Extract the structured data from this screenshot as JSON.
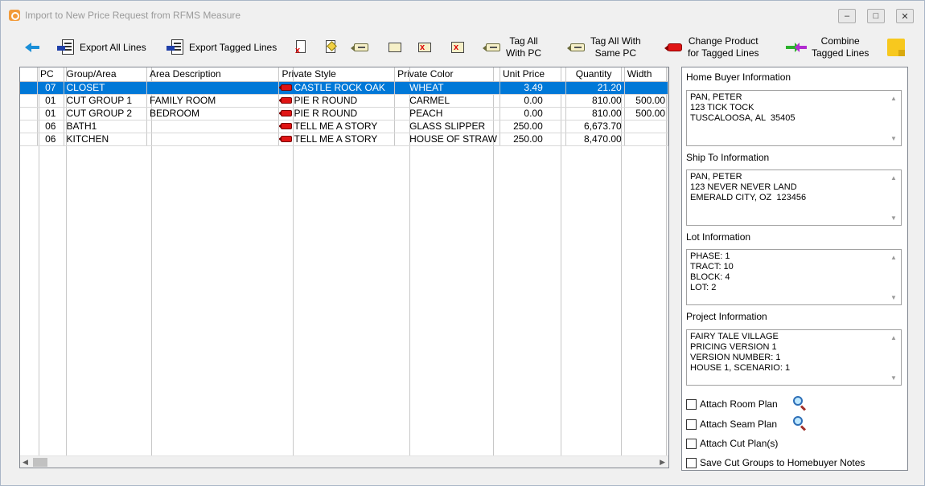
{
  "window": {
    "title": "Import to New Price Request from RFMS Measure"
  },
  "toolbar": {
    "export_all": "Export All Lines",
    "export_tagged": "Export Tagged Lines",
    "tag_all_pc_1": "Tag All",
    "tag_all_pc_2": "With PC",
    "tag_same_pc_1": "Tag All With",
    "tag_same_pc_2": "Same PC",
    "change_product_1": "Change Product",
    "change_product_2": "for Tagged Lines",
    "combine_1": "Combine",
    "combine_2": "Tagged Lines"
  },
  "grid": {
    "columns": [
      "PC",
      "Group/Area",
      "Area Description",
      "Private Style",
      "Private Color",
      "Unit Price",
      "Quantity",
      "Width"
    ],
    "rows": [
      {
        "pc": "07",
        "group": "CLOSET",
        "desc": "",
        "style": "CASTLE ROCK OAK",
        "color": "WHEAT",
        "price": "3.49",
        "qty": "21.20",
        "width": ""
      },
      {
        "pc": "01",
        "group": "CUT GROUP 1",
        "desc": "FAMILY ROOM",
        "style": "PIE R ROUND",
        "color": "CARMEL",
        "price": "0.00",
        "qty": "810.00",
        "width": "500.00"
      },
      {
        "pc": "01",
        "group": "CUT GROUP 2",
        "desc": "BEDROOM",
        "style": "PIE R ROUND",
        "color": "PEACH",
        "price": "0.00",
        "qty": "810.00",
        "width": "500.00"
      },
      {
        "pc": "06",
        "group": "BATH1",
        "desc": "",
        "style": "TELL ME A STORY",
        "color": "GLASS SLIPPER",
        "price": "250.00",
        "qty": "6,673.70",
        "width": ""
      },
      {
        "pc": "06",
        "group": "KITCHEN",
        "desc": "",
        "style": "TELL ME A STORY",
        "color": "HOUSE OF STRAW",
        "price": "250.00",
        "qty": "8,470.00",
        "width": ""
      }
    ]
  },
  "panel": {
    "home_buyer_label": "Home Buyer Information",
    "home_buyer": [
      "PAN, PETER",
      "123 TICK TOCK",
      "TUSCALOOSA, AL  35405"
    ],
    "ship_to_label": "Ship To Information",
    "ship_to": [
      "PAN, PETER",
      "123 NEVER NEVER LAND",
      "EMERALD CITY, OZ  123456"
    ],
    "lot_label": "Lot Information",
    "lot": [
      "",
      "PHASE: 1",
      "TRACT: 10",
      "BLOCK: 4",
      "LOT: 2"
    ],
    "project_label": "Project Information",
    "project": [
      "FAIRY TALE VILLAGE",
      "PRICING VERSION 1",
      "VERSION NUMBER: 1",
      "HOUSE 1, SCENARIO: 1"
    ],
    "attach_room": "Attach Room Plan",
    "attach_seam": "Attach Seam Plan",
    "attach_cut": "Attach Cut Plan(s)",
    "save_cut": "Save Cut Groups to Homebuyer Notes"
  }
}
